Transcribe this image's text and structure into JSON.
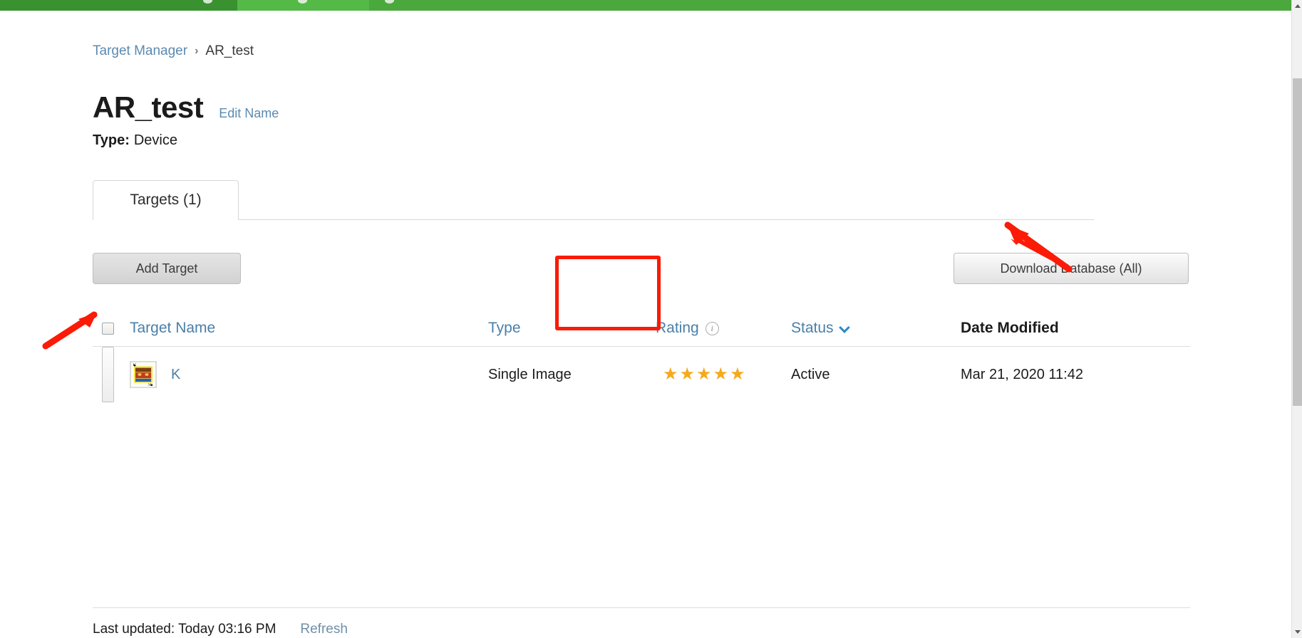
{
  "topnav": {
    "segments": [
      "nav-left",
      "nav-active",
      "nav-right"
    ],
    "bg_color": "#3e9b31",
    "active_color": "#55b947"
  },
  "breadcrumb": {
    "root_label": "Target Manager",
    "separator": "›",
    "current_label": "AR_test"
  },
  "header": {
    "title": "AR_test",
    "edit_name_label": "Edit Name",
    "type_label": "Type:",
    "type_value": "Device"
  },
  "tabs": [
    {
      "label": "Targets (1)",
      "active": true
    }
  ],
  "toolbar": {
    "add_target_label": "Add Target",
    "download_database_label": "Download Database (All)"
  },
  "table": {
    "columns": [
      {
        "key": "check",
        "label": "",
        "sortable": false
      },
      {
        "key": "name",
        "label": "Target Name",
        "sortable": true
      },
      {
        "key": "type",
        "label": "Type",
        "sortable": true
      },
      {
        "key": "rating",
        "label": "Rating",
        "sortable": true,
        "info_icon": "i"
      },
      {
        "key": "status",
        "label": "Status",
        "sortable": true,
        "sorted": true
      },
      {
        "key": "date",
        "label": "Date Modified",
        "sortable": false
      }
    ],
    "rows": [
      {
        "checked": false,
        "thumbnail": "king-of-spades-card",
        "name": "K",
        "type": "Single Image",
        "rating_value": 5,
        "rating_max": 5,
        "status": "Active",
        "date_modified": "Mar 21, 2020 11:42"
      }
    ]
  },
  "footer": {
    "last_updated": "Last updated: Today 03:16 PM",
    "refresh_label": "Refresh"
  },
  "annotations": {
    "highlight_color": "#fb1b06",
    "box_target": "rating-column",
    "arrow_right_target": "download-database-button",
    "arrow_left_target": "row-checkbox"
  },
  "colors": {
    "link": "#4a7fa8",
    "star": "#f6a91b",
    "sort_chevron": "#2f87c4",
    "nav_green": "#3e9b31"
  }
}
